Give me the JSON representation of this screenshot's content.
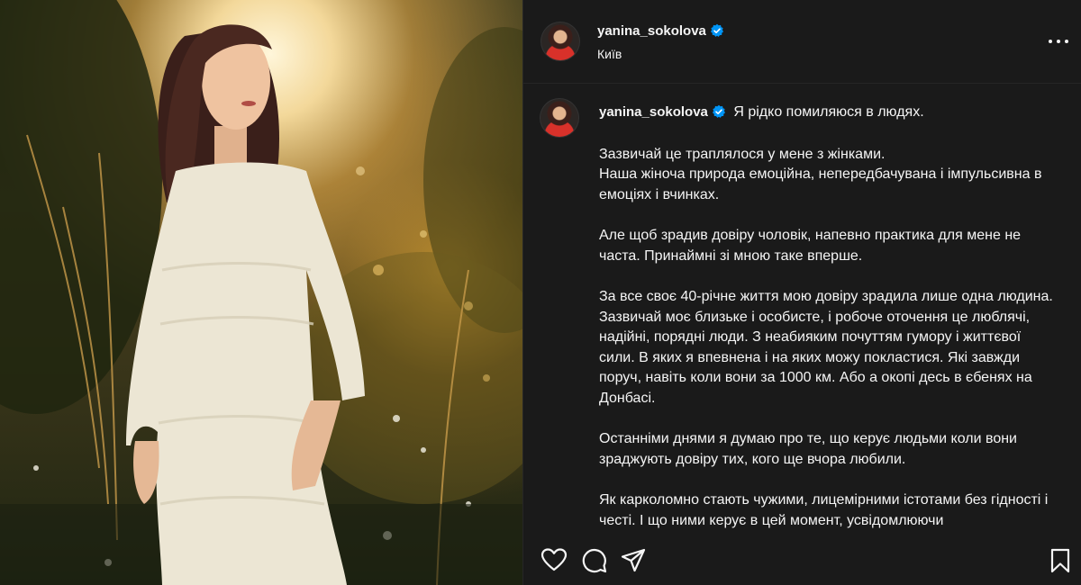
{
  "post": {
    "username": "yanina_sokolova",
    "location": "Київ",
    "verified_color": "#0095f6"
  },
  "caption": {
    "first_line": "Я рідко помиляюся в людях.",
    "paragraphs": [
      "Зазвичай це траплялося у мене з жінками.\nНаша жіноча природа емоційна, непередбачувана і імпульсивна в емоціях і вчинках.",
      "Але щоб зрадив довіру чоловік, напевно практика для мене не часта. Принаймні зі мною таке вперше.",
      "За все своє 40-річне життя мою довіру зрадила лише одна людина. Зазвичай моє близьке і особисте, і робоче оточення це люблячі, надійні, порядні люди. З неабияким почуттям гумору і життєвої сили. В яких я впевнена і на яких можу покластися. Які завжди поруч, навіть коли вони за 1000 км. Або а окопі десь в єбенях на Донбасі.",
      "Останніми днями я думаю про те, що керує людьми коли вони зраджують довіру тих, кого ще вчора любили.",
      "Як карколомно стають чужими, лицемірними істотами без гідності і честі. І що ними керує в цей момент, усвідомлюючи"
    ]
  },
  "icons": {
    "like": "heart-icon",
    "comment": "comment-icon",
    "share": "share-icon",
    "save": "bookmark-icon",
    "more": "more-options-icon",
    "verified": "verified-badge-icon"
  }
}
